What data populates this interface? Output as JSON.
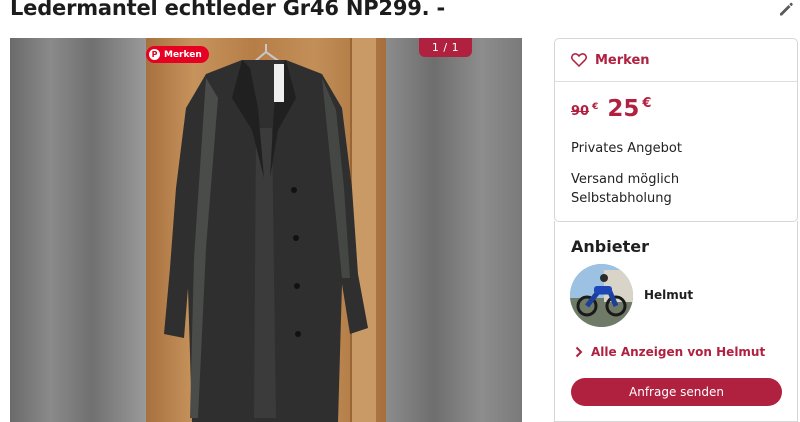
{
  "listing": {
    "title": "Ledermantel echtleder Gr46 NP299. -",
    "edit_icon": "pencil-icon"
  },
  "gallery": {
    "pin_label": "Merken",
    "counter": "1 / 1"
  },
  "sidebar": {
    "merken_label": "Merken",
    "old_price": "90",
    "currency": "€",
    "price": "25",
    "offer_type": "Privates Angebot",
    "shipping": "Versand möglich",
    "pickup": "Selbstabholung"
  },
  "seller": {
    "heading": "Anbieter",
    "name": "Helmut",
    "all_ads_label": "Alle Anzeigen von Helmut",
    "send_button": "Anfrage senden"
  },
  "colors": {
    "accent": "#b0203f",
    "pinterest": "#e60023"
  }
}
